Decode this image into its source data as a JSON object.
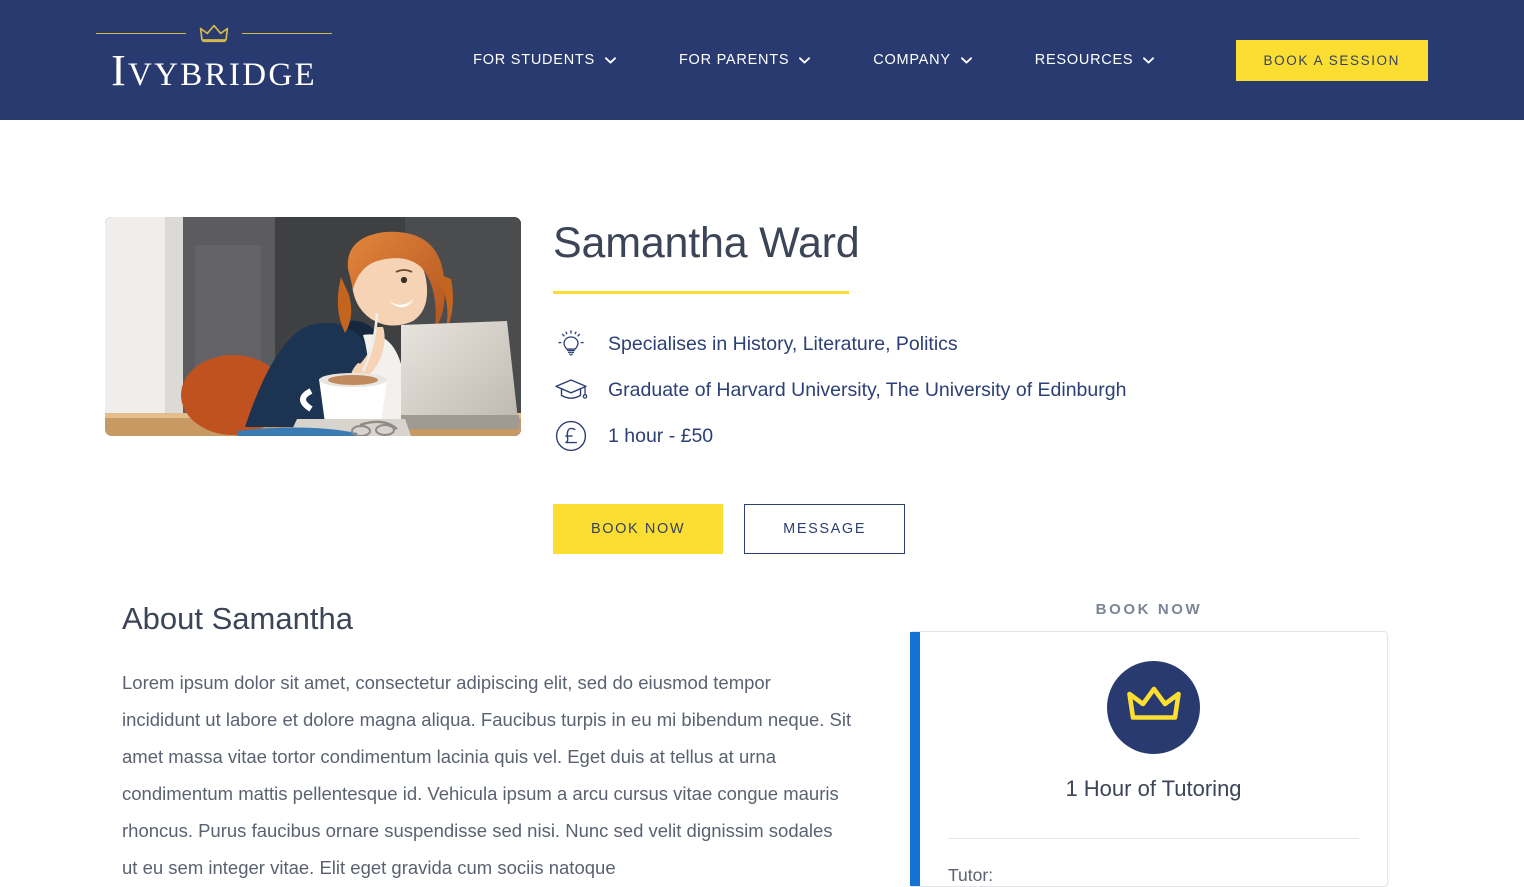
{
  "theme": {
    "navy": "#283A70",
    "yellow": "#FCDE33",
    "accent_blue": "#1572D3",
    "text_dark": "#3C4557",
    "text_muted": "#5A6272"
  },
  "header": {
    "brand": {
      "name_first_letter": "I",
      "name_rest": "VYBRIDGE",
      "crown_icon": "crown-icon"
    },
    "nav": [
      {
        "label": "FOR STUDENTS",
        "icon": "chevron-down-icon"
      },
      {
        "label": "FOR PARENTS",
        "icon": "chevron-down-icon"
      },
      {
        "label": "COMPANY",
        "icon": "chevron-down-icon"
      },
      {
        "label": "RESOURCES",
        "icon": "chevron-down-icon"
      }
    ],
    "cta_label": "BOOK A SESSION"
  },
  "profile": {
    "photo_alt": "tutor-photo",
    "name": "Samantha Ward",
    "details": [
      {
        "icon": "lightbulb-icon",
        "text": "Specialises in History, Literature, Politics"
      },
      {
        "icon": "graduation-cap-icon",
        "text": "Graduate of Harvard University, The University of Edinburgh"
      },
      {
        "icon": "pound-circle-icon",
        "text": "1 hour - £50"
      }
    ],
    "actions": {
      "book_label": "BOOK NOW",
      "message_label": "MESSAGE"
    }
  },
  "about": {
    "title": "About Samantha",
    "body": "Lorem ipsum dolor sit amet, consectetur adipiscing elit, sed do eiusmod tempor incididunt ut labore et dolore magna aliqua. Faucibus turpis in eu mi bibendum neque. Sit amet massa vitae tortor condimentum lacinia quis vel. Eget duis at tellus at urna condimentum mattis pellentesque id. Vehicula ipsum a arcu cursus vitae congue mauris rhoncus. Purus faucibus ornare suspendisse sed nisi. Nunc sed velit dignissim sodales ut eu sem integer vitae. Elit eget gravida cum sociis natoque"
  },
  "booking": {
    "heading": "BOOK NOW",
    "crown_icon": "crown-icon",
    "package_title": "1 Hour of Tutoring",
    "tutor_label": "Tutor:"
  }
}
